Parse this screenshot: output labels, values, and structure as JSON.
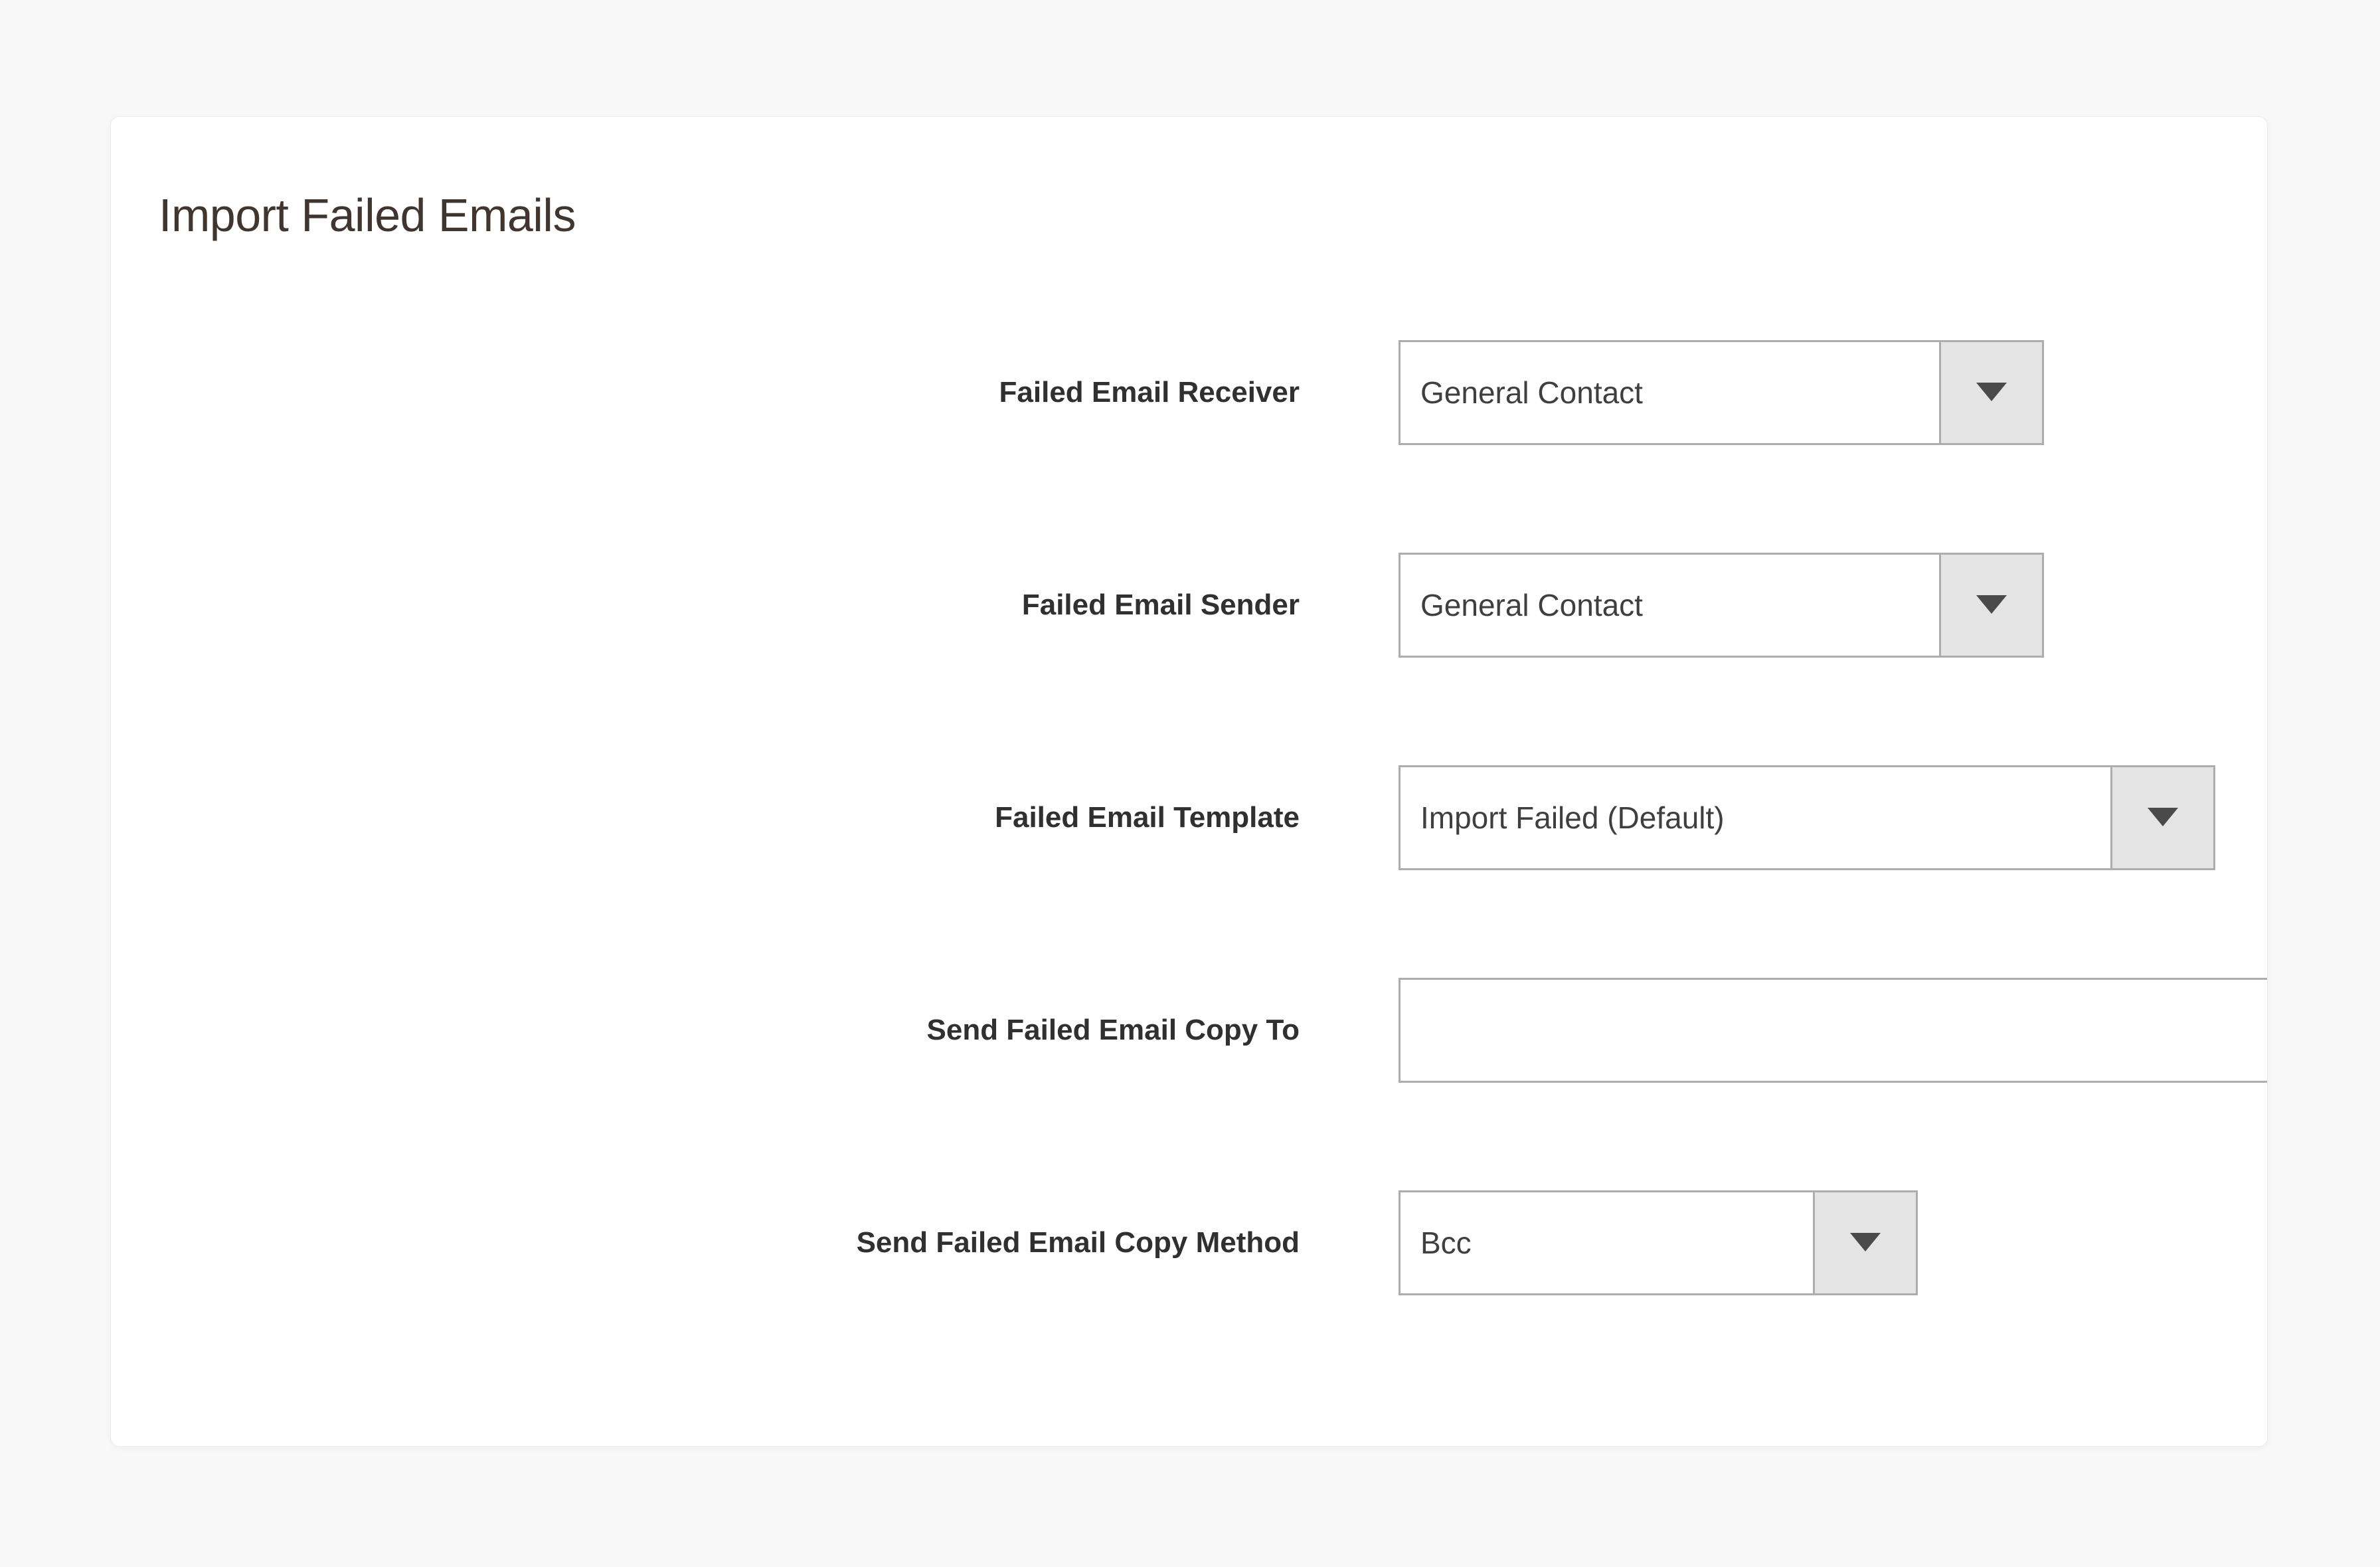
{
  "page": {
    "background_color": "#f8f8f8",
    "card_background_color": "#ffffff"
  },
  "panel": {
    "title": "Import Failed Emails",
    "title_color": "#41362f"
  },
  "icons": {
    "dropdown_arrow": "chevron-down-icon"
  },
  "form": {
    "rows": [
      {
        "label": "Failed Email Receiver",
        "control": "select",
        "value": "General Contact"
      },
      {
        "label": "Failed Email Sender",
        "control": "select",
        "value": "General Contact"
      },
      {
        "label": "Failed Email Template",
        "control": "select",
        "value": "Import Failed (Default)"
      },
      {
        "label": "Send Failed Email Copy To",
        "control": "text",
        "value": "",
        "placeholder": ""
      },
      {
        "label": "Send Failed Email Copy Method",
        "control": "select",
        "value": "Bcc"
      }
    ]
  }
}
